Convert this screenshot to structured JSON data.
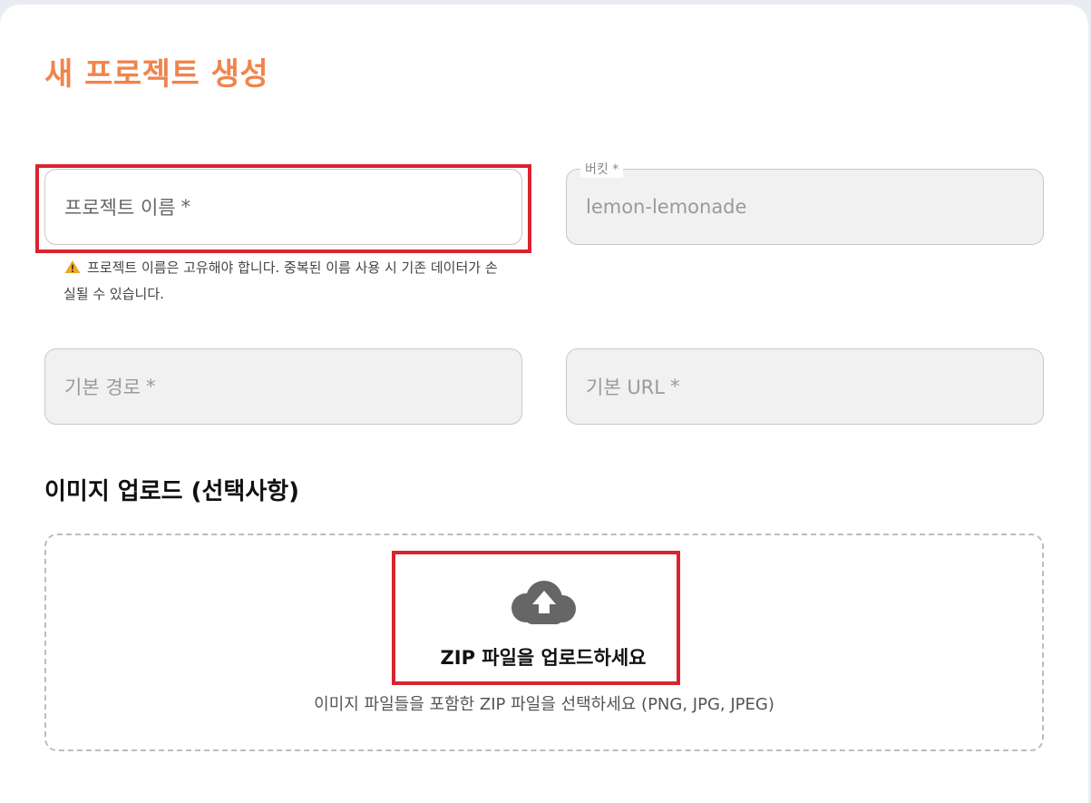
{
  "page_title": "새 프로젝트 생성",
  "project_name": {
    "placeholder": "프로젝트 이름",
    "required_mark": "*",
    "warning_icon": "warning-icon",
    "warning_text": "프로젝트 이름은 고유해야 합니다. 중복된 이름 사용 시 기존 데이터가 손실될 수 있습니다."
  },
  "bucket": {
    "label": "버킷 *",
    "value": "lemon-lemonade"
  },
  "base_path": {
    "placeholder": "기본 경로",
    "required_mark": "*"
  },
  "base_url": {
    "placeholder": "기본 URL",
    "required_mark": "*"
  },
  "image_upload": {
    "section_title": "이미지 업로드 (선택사항)",
    "icon": "cloud-upload-icon",
    "title": "ZIP 파일을 업로드하세요",
    "subtitle": "이미지 파일들을 포함한 ZIP 파일을 선택하세요 (PNG, JPG, JPEG)"
  },
  "colors": {
    "title_accent": "#f0844c",
    "highlight_border": "#d9242f",
    "warning_icon": "#f2a623",
    "upload_icon": "#666666"
  }
}
